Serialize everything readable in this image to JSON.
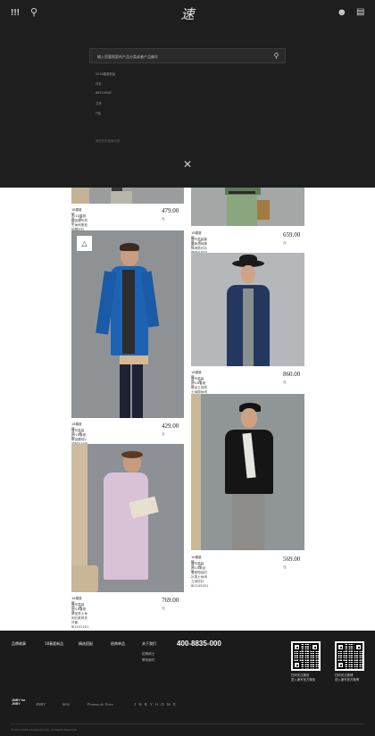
{
  "header": {
    "logo_text": "速写"
  },
  "search": {
    "placeholder": "输入您要搜索的产品分类或者产品编号",
    "suggestions": [
      "2018春夏新品",
      "衬衫",
      "86510M4C",
      "卫衣",
      "T恤"
    ],
    "history_label": "清空历史搜索记录"
  },
  "products": [
    {
      "category": "18春夏新品",
      "type": "衬衫",
      "name": "2018春夏新品速写男士休闲宽松纯棉衬衫8I2106011",
      "price": "479.00",
      "unit": "元"
    },
    {
      "category": "18春夏新品",
      "type": "衬衫",
      "name": "速写男装春夏新品纯棉休闲男衬衫翻领长袖衬衫8I2101271",
      "price": "659.00",
      "unit": "元"
    },
    {
      "category": "18春夏新品",
      "type": "针织",
      "name": "速写男装2018春夏新品翻领V领开衫针织外套男装8I2302011",
      "price": "429.00",
      "unit": "元"
    },
    {
      "category": "18春夏新品",
      "type": "衬衫",
      "name": "速写男装2018春夏新品立领男士纯棉休闲长袖衬衫8I2106031",
      "price": "860.00",
      "unit": "元"
    },
    {
      "category": "18春夏新品",
      "type": "风衣",
      "name": "速写男装2018春夏新品男士休闲长款风衣外套8I2102201",
      "price": "769.00",
      "unit": "元"
    },
    {
      "category": "18春夏新品",
      "type": "衬衫",
      "name": "速写男装2018新品春夏短袖衬衫男士休闲立领衬衫8I2105051",
      "price": "569.00",
      "unit": "元"
    }
  ],
  "footer": {
    "nav": [
      "品牌故事",
      "18春夏新品",
      "精选搭配",
      "经典单品",
      "关于我们"
    ],
    "about_sub": [
      "招贤纳士",
      "联系我们"
    ],
    "phone": "400-8835-000",
    "qr_captions": [
      [
        "扫码关注微信",
        "进入速写官方微信"
      ],
      [
        "扫码关注微博",
        "进入速写官方微博"
      ]
    ],
    "brands": [
      "JNBY for JNBY",
      "JNBY",
      "less",
      "Pomme de Terre",
      "J N B Y H O M E"
    ],
    "copyright": "©2013-2018 jnbybrand.com, All Rights Reserved"
  },
  "colors": {
    "header_bg": "#1e1e1e",
    "footer_bg": "#1b1b1b",
    "page_bg": "#ffffff"
  }
}
